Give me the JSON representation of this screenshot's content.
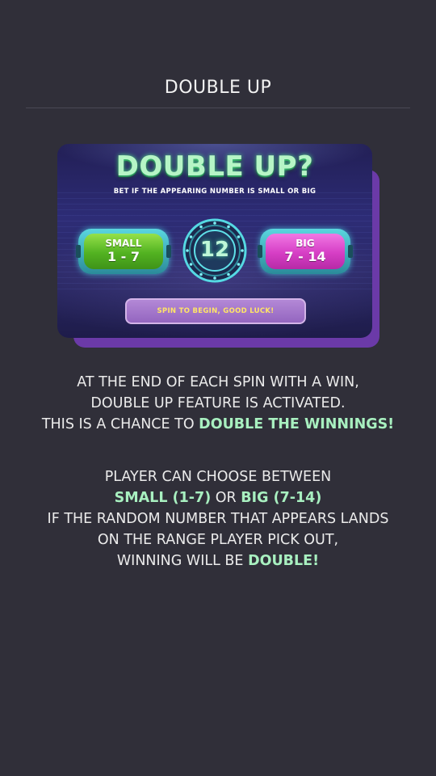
{
  "page": {
    "title": "DOUBLE UP"
  },
  "illustration": {
    "title": "DOUBLE UP?",
    "subtitle": "BET IF THE APPEARING NUMBER IS SMALL OR BIG",
    "small_button": {
      "label": "SMALL",
      "range": "1 - 7"
    },
    "big_button": {
      "label": "BIG",
      "range": "7 - 14"
    },
    "number": "12",
    "status": "SPIN TO BEGIN, GOOD LUCK!"
  },
  "description_1": {
    "line1": "AT THE END OF EACH SPIN WITH A WIN,",
    "line2": "DOUBLE UP FEATURE IS ACTIVATED.",
    "line3_prefix": "THIS IS A CHANCE TO ",
    "line3_highlight": "DOUBLE THE WINNINGS!"
  },
  "description_2": {
    "line1": "PLAYER CAN CHOOSE BETWEEN",
    "line2_small": "SMALL (1-7)",
    "line2_or": " OR ",
    "line2_big": "BIG (7-14)",
    "line3": "IF THE RANDOM NUMBER THAT APPEARS LANDS",
    "line4": "ON THE RANGE PLAYER PICK OUT,",
    "line5_prefix": "WINNING WILL BE ",
    "line5_highlight": "DOUBLE!"
  },
  "colors": {
    "background": "#302f39",
    "highlight": "#a8f0c0",
    "card_shadow": "#6b3aa8",
    "small_green": "#52b221",
    "big_magenta": "#d63ec5"
  }
}
